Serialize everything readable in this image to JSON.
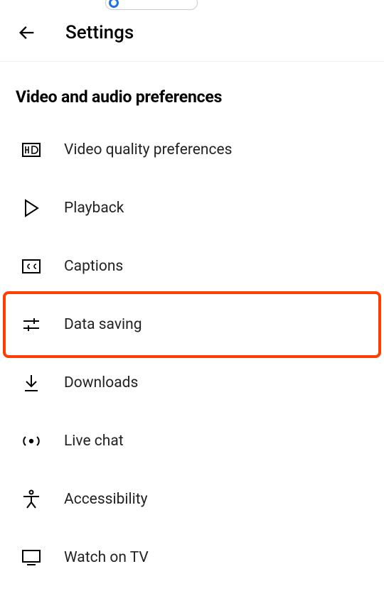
{
  "header": {
    "title": "Settings"
  },
  "section_heading": "Video and audio preferences",
  "menu": {
    "items": [
      {
        "label": "Video quality preferences"
      },
      {
        "label": "Playback"
      },
      {
        "label": "Captions"
      },
      {
        "label": "Data saving"
      },
      {
        "label": "Downloads"
      },
      {
        "label": "Live chat"
      },
      {
        "label": "Accessibility"
      },
      {
        "label": "Watch on TV"
      }
    ]
  },
  "highlighted_index": 3
}
